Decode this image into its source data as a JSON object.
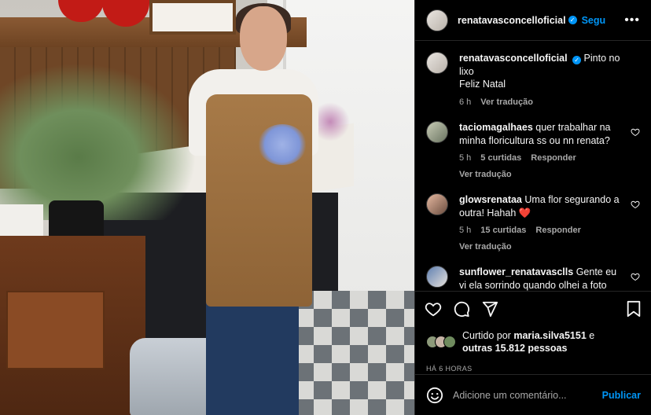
{
  "header": {
    "username": "renatavasconcelloficial",
    "follow_label": "Segu",
    "more": "•••"
  },
  "caption": {
    "username": "renatavasconcelloficial",
    "text": "Pinto no lixo",
    "line2": "Feliz Natal",
    "time": "6 h",
    "translate": "Ver tradução"
  },
  "comments": [
    {
      "username": "taciomagalhaes",
      "text": "quer trabalhar na minha floricultura ss ou nn renata?",
      "time": "5 h",
      "likes": "5 curtidas",
      "reply": "Responder",
      "translate": "Ver tradução"
    },
    {
      "username": "glowsrenataa",
      "text": "Uma flor segurando a outra! Hahah",
      "emoji": "❤️",
      "time": "5 h",
      "likes": "15 curtidas",
      "reply": "Responder",
      "translate": "Ver tradução"
    },
    {
      "username": "sunflower_renatavasclls",
      "text": "Gente eu vi ela sorrindo quando olhei a foto"
    }
  ],
  "likes": {
    "prefix": "Curtido por",
    "user": "maria.silva5151",
    "conj": "e",
    "others": "outras 15.812 pessoas"
  },
  "time_ago": "HÁ 6 HORAS",
  "add_comment": {
    "placeholder": "Adicione um comentário...",
    "post": "Publicar"
  },
  "icons": [
    "heart-icon",
    "comment-icon",
    "share-icon",
    "bookmark-icon",
    "emoji-icon",
    "verified-icon",
    "more-icon"
  ],
  "colors": {
    "accent": "#0095f6",
    "background": "#000000",
    "text": "#f5f5f5",
    "muted": "#a8a8a8"
  }
}
